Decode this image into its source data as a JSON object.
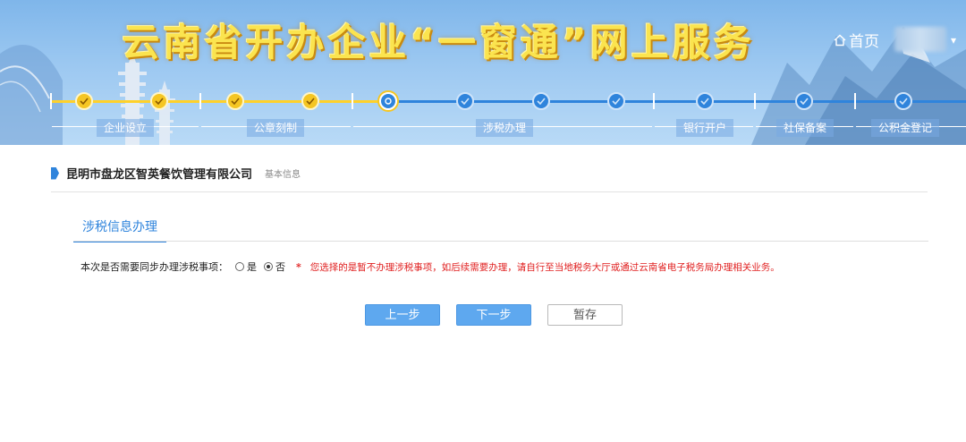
{
  "banner": {
    "title": "云南省开办企业“一窗通”网上服务",
    "home_label": "首页"
  },
  "progress": {
    "stages": [
      "企业设立",
      "公章刻制",
      "涉税办理",
      "银行开户",
      "社保备案",
      "公积金登记"
    ],
    "completed_steps": 4,
    "current_step": 5,
    "total_steps": 12
  },
  "company": {
    "name": "昆明市盘龙区智英餐饮管理有限公司",
    "subtitle": "基本信息"
  },
  "tab": {
    "label": "涉税信息办理"
  },
  "question": {
    "label": "本次是否需要同步办理涉税事项：",
    "options": [
      "是",
      "否"
    ],
    "selected": "否",
    "required_mark": "*",
    "warning": "您选择的是暂不办理涉税事项，如后续需要办理，请自行至当地税务大厅或通过云南省电子税务局办理相关业务。"
  },
  "buttons": {
    "prev": "上一步",
    "next": "下一步",
    "save": "暂存"
  },
  "colors": {
    "accent": "#2f84dc",
    "done": "#f5c623",
    "warning": "#e02020"
  }
}
